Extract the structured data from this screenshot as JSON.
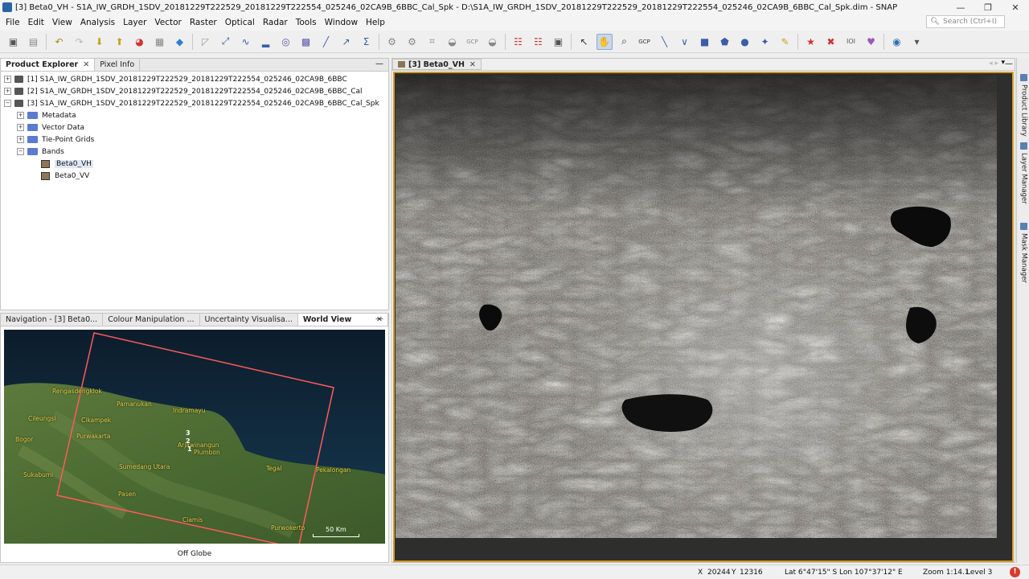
{
  "window": {
    "title": "[3] Beta0_VH - S1A_IW_GRDH_1SDV_20181229T222529_20181229T222554_025246_02CA9B_6BBC_Cal_Spk - D:\\S1A_IW_GRDH_1SDV_20181229T222529_20181229T222554_025246_02CA9B_6BBC_Cal_Spk.dim - SNAP",
    "controls": {
      "minimize": "—",
      "restore": "❐",
      "close": "✕"
    }
  },
  "menubar": {
    "items": [
      "File",
      "Edit",
      "View",
      "Analysis",
      "Layer",
      "Vector",
      "Raster",
      "Optical",
      "Radar",
      "Tools",
      "Window",
      "Help"
    ]
  },
  "search": {
    "placeholder": "Search (Ctrl+I)"
  },
  "toolbar": {
    "icons": [
      "new-product-icon",
      "open-icon",
      "undo-icon",
      "redo-icon",
      "import-icon",
      "export-icon",
      "rgb-icon",
      "band-maths-icon",
      "statistics-icon",
      "graph-builder-icon",
      "range-finder-icon",
      "spectrum-icon",
      "histogram-icon",
      "profile-icon",
      "scatter-icon",
      "sigma-icon",
      "gcp-icon",
      "pin-manager-icon",
      "grid-icon",
      "mask-icon",
      "select-tool-icon",
      "pan-tool-icon",
      "zoom-tool-icon",
      "gcp-tool-icon",
      "line-tool-icon",
      "polyline-tool-icon",
      "rectangle-tool-icon",
      "polygon-tool-icon",
      "ellipse-tool-icon",
      "magic-wand-icon",
      "draw-icon",
      "star-icon",
      "sync-cursor-icon",
      "sync-view-icon",
      "world-icon"
    ],
    "labels": {
      "gcp": "GCP",
      "gcp2": "GCP",
      "gcp_tool": "GCP",
      "ioi": "IOI"
    }
  },
  "product_explorer": {
    "tabs": [
      {
        "label": "Product Explorer",
        "active": true
      },
      {
        "label": "Pixel Info",
        "active": false
      }
    ],
    "products": [
      "[1] S1A_IW_GRDH_1SDV_20181229T222529_20181229T222554_025246_02CA9B_6BBC",
      "[2] S1A_IW_GRDH_1SDV_20181229T222529_20181229T222554_025246_02CA9B_6BBC_Cal",
      "[3] S1A_IW_GRDH_1SDV_20181229T222529_20181229T222554_025246_02CA9B_6BBC_Cal_Spk"
    ],
    "folders": [
      "Metadata",
      "Vector Data",
      "Tie-Point Grids",
      "Bands"
    ],
    "bands": [
      "Beta0_VH",
      "Beta0_VV"
    ],
    "selected_band": "Beta0_VH"
  },
  "bottom_panel": {
    "tabs": [
      {
        "label": "Navigation - [3] Beta0...",
        "active": false
      },
      {
        "label": "Colour Manipulation ...",
        "active": false
      },
      {
        "label": "Uncertainty Visualisa...",
        "active": false
      },
      {
        "label": "World View",
        "active": true
      }
    ],
    "places": [
      "Rengasdengklok",
      "Pamanukan",
      "Indramayu",
      "Cileungsi",
      "Cikampek",
      "Purwakarta",
      "Bogor",
      "Sumedang Utara",
      "Sukabumi",
      "Pasen",
      "Ciamis",
      "Tegal",
      "Pekalongan",
      "Purwokerto",
      "Arjawinangun",
      "Plumbon"
    ],
    "footprint_labels": [
      "3",
      "2",
      "1"
    ],
    "scale_label": "50 Km",
    "globe_label": "Off Globe",
    "colors": {
      "ocean": "#0e2233",
      "land": "#4f6b36",
      "footprint": "#ff5a5a",
      "place_text": "#e8d04a"
    }
  },
  "image_view": {
    "tab_label": "[3] Beta0_VH",
    "colors": {
      "frame": "#d29a28",
      "background": "#2e2e2e"
    }
  },
  "side_tabs": [
    "Product Library",
    "Layer Manager",
    "Mask Manager"
  ],
  "statusbar": {
    "x_label": "X",
    "x": "20244",
    "y_label": "Y",
    "y": "12316",
    "lat": "Lat 6°47'15\" S",
    "lon": "Lon 107°37'12\" E",
    "zoom": "Zoom 1:14.1",
    "level": "Level 3",
    "error_badge": "!"
  }
}
